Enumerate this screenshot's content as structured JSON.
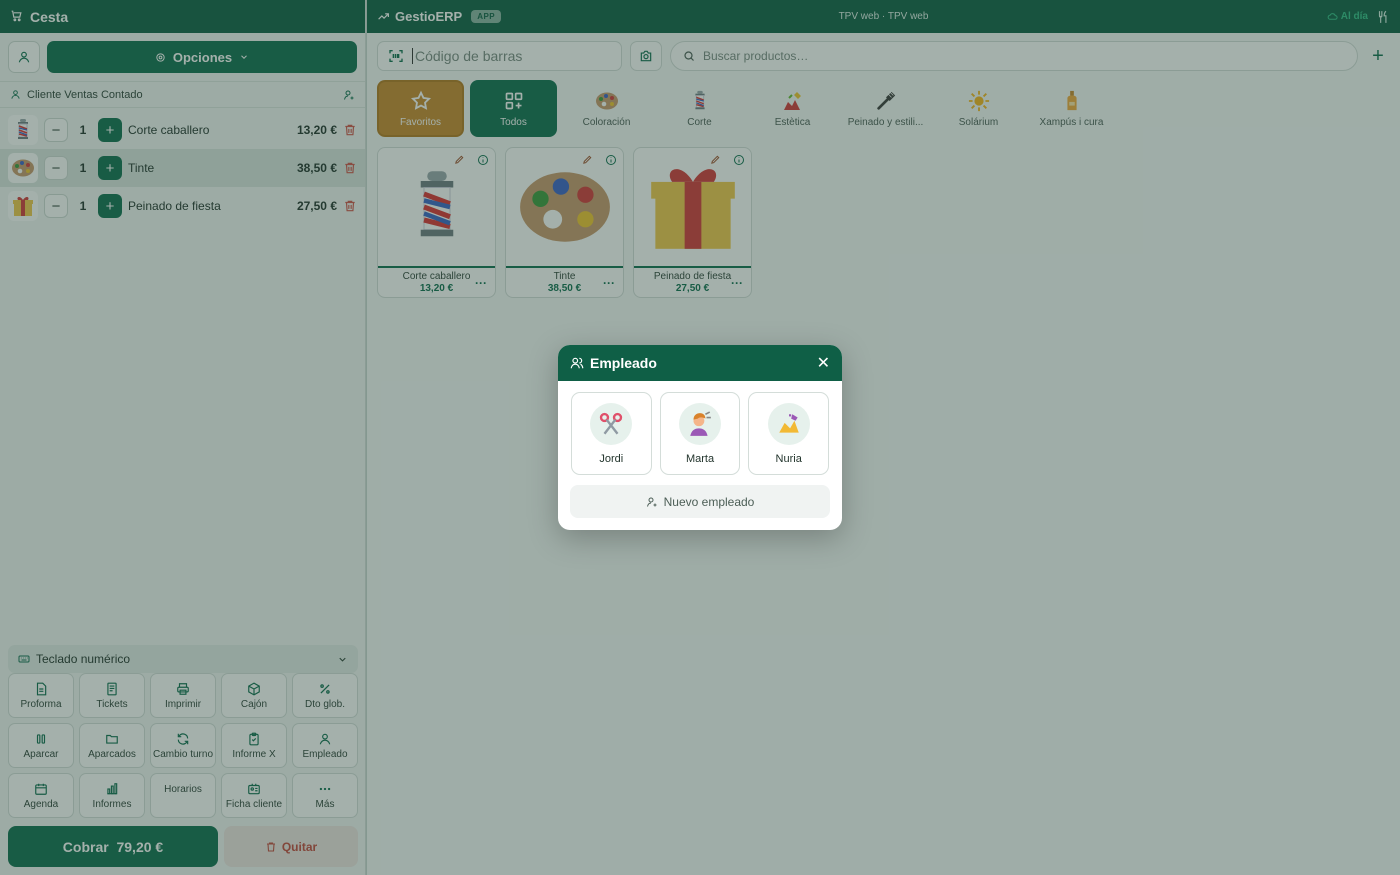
{
  "left": {
    "title": "Cesta",
    "options_label": "Opciones",
    "client_label": "Cliente Ventas Contado",
    "items": [
      {
        "icon": "barber-pole-icon",
        "qty": "1",
        "name": "Corte caballero",
        "price": "13,20 €"
      },
      {
        "icon": "palette-icon",
        "qty": "1",
        "name": "Tinte",
        "price": "38,50 €"
      },
      {
        "icon": "gift-icon",
        "qty": "1",
        "name": "Peinado de fiesta",
        "price": "27,50 €"
      }
    ],
    "numpad_label": "Teclado numérico",
    "actions": [
      {
        "icon": "document-icon",
        "label": "Proforma"
      },
      {
        "icon": "receipt-icon",
        "label": "Tickets"
      },
      {
        "icon": "printer-icon",
        "label": "Imprimir"
      },
      {
        "icon": "box-icon",
        "label": "Cajón"
      },
      {
        "icon": "percent-icon",
        "label": "Dto glob."
      },
      {
        "icon": "pause-icon",
        "label": "Aparcar"
      },
      {
        "icon": "folder-icon",
        "label": "Aparcados"
      },
      {
        "icon": "refresh-icon",
        "label": "Cambio turno"
      },
      {
        "icon": "clipboard-icon",
        "label": "Informe X"
      },
      {
        "icon": "user-icon",
        "label": "Empleado"
      },
      {
        "icon": "calendar-icon",
        "label": "Agenda"
      },
      {
        "icon": "bar-chart-icon",
        "label": "Informes"
      },
      {
        "icon": "",
        "label": "Horarios"
      },
      {
        "icon": "id-card-icon",
        "label": "Ficha cliente"
      },
      {
        "icon": "more-icon",
        "label": "Más"
      }
    ],
    "charge_label": "Cobrar",
    "charge_total": "79,20 €",
    "remove_label": "Quitar"
  },
  "topbar": {
    "brand": "GestioERP",
    "badge": "APP",
    "center_title": "TPV web · TPV web",
    "status": "Al día"
  },
  "search": {
    "barcode_placeholder": "Código de barras",
    "search_placeholder": "Buscar productos…"
  },
  "categories": [
    {
      "icon": "star-icon",
      "label": "Favoritos"
    },
    {
      "icon": "grid-icon",
      "label": "Todos"
    },
    {
      "icon": "palette-icon",
      "label": "Coloración"
    },
    {
      "icon": "barber-pole-icon",
      "label": "Corte"
    },
    {
      "icon": "nail-polish-icon",
      "label": "Estètica"
    },
    {
      "icon": "comb-icon",
      "label": "Peinado y estili..."
    },
    {
      "icon": "sun-icon",
      "label": "Solárium"
    },
    {
      "icon": "lotion-bottle-icon",
      "label": "Xampús i cura"
    }
  ],
  "products": [
    {
      "icon": "barber-pole-icon",
      "name": "Corte caballero",
      "price": "13,20 €"
    },
    {
      "icon": "palette-icon",
      "name": "Tinte",
      "price": "38,50 €"
    },
    {
      "icon": "gift-icon",
      "name": "Peinado de fiesta",
      "price": "27,50 €"
    }
  ],
  "modal": {
    "title": "Empleado",
    "employees": [
      {
        "icon": "scissors-icon",
        "name": "Jordi"
      },
      {
        "icon": "hairdresser-icon",
        "name": "Marta"
      },
      {
        "icon": "nail-polish-icon",
        "name": "Nuria"
      }
    ],
    "new_employee_label": "Nuevo empleado"
  }
}
